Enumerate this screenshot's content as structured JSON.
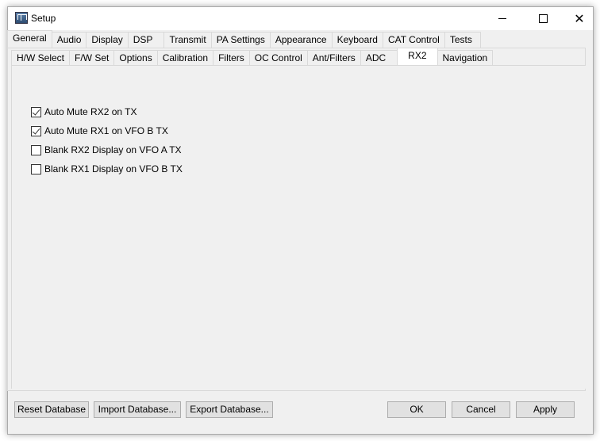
{
  "window": {
    "title": "Setup",
    "icon": "app-icon",
    "controls": {
      "minimize": "minimize-icon",
      "maximize": "maximize-icon",
      "close": "close-icon"
    }
  },
  "main_tabs": [
    {
      "label": "General",
      "active": true
    },
    {
      "label": "Audio",
      "active": false
    },
    {
      "label": "Display",
      "active": false
    },
    {
      "label": "DSP",
      "active": false
    },
    {
      "label": "Transmit",
      "active": false
    },
    {
      "label": "PA Settings",
      "active": false
    },
    {
      "label": "Appearance",
      "active": false
    },
    {
      "label": "Keyboard",
      "active": false
    },
    {
      "label": "CAT Control",
      "active": false
    },
    {
      "label": "Tests",
      "active": false
    }
  ],
  "sub_tabs": [
    {
      "label": "H/W Select",
      "active": false
    },
    {
      "label": "F/W Set",
      "active": false
    },
    {
      "label": "Options",
      "active": false
    },
    {
      "label": "Calibration",
      "active": false
    },
    {
      "label": "Filters",
      "active": false
    },
    {
      "label": "OC Control",
      "active": false
    },
    {
      "label": "Ant/Filters",
      "active": false
    },
    {
      "label": "ADC",
      "active": false
    },
    {
      "label": "RX2",
      "active": true
    },
    {
      "label": "Navigation",
      "active": false
    }
  ],
  "options": [
    {
      "label": "Auto Mute RX2 on TX",
      "checked": true
    },
    {
      "label": "Auto Mute RX1 on VFO B TX",
      "checked": true
    },
    {
      "label": "Blank RX2 Display on VFO A TX",
      "checked": false
    },
    {
      "label": "Blank RX1 Display on VFO B TX",
      "checked": false
    }
  ],
  "buttons": {
    "reset": "Reset Database",
    "import": "Import Database...",
    "export": "Export Database...",
    "ok": "OK",
    "cancel": "Cancel",
    "apply": "Apply"
  }
}
